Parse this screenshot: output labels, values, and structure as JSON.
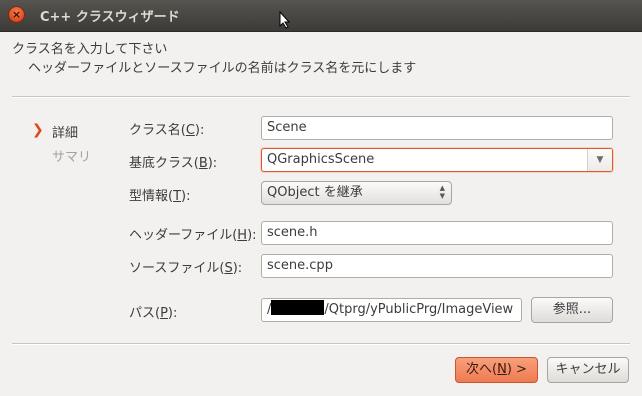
{
  "window": {
    "title": "C++ クラスウィザード",
    "close_glyph": "×"
  },
  "header": {
    "line1": "クラス名を入力して下さい",
    "line2": "ヘッダーファイルとソースファイルの名前はクラス名を元にします"
  },
  "sidebar": {
    "active_marker": "❯",
    "items": [
      {
        "label": "詳細",
        "active": true
      },
      {
        "label": "サマリ",
        "active": false
      }
    ]
  },
  "form": {
    "class_name": {
      "label_pre": "クラス名(",
      "mnemonic": "C",
      "label_post": "):",
      "value": "Scene"
    },
    "base_class": {
      "label_pre": "基底クラス(",
      "mnemonic": "B",
      "label_post": "):",
      "value": "QGraphicsScene"
    },
    "type_info": {
      "label_pre": "型情報(",
      "mnemonic": "T",
      "label_post": "):",
      "value": "QObject を継承"
    },
    "header_file": {
      "label_pre": "ヘッダーファイル(",
      "mnemonic": "H",
      "label_post": "):",
      "value": "scene.h"
    },
    "source_file": {
      "label_pre": "ソースファイル(",
      "mnemonic": "S",
      "label_post": "):",
      "value": "scene.cpp"
    },
    "path": {
      "label_pre": "パス(",
      "mnemonic": "P",
      "label_post": "):",
      "prefix": "/",
      "suffix": "/Qtprg/yPublicPrg/ImageView"
    }
  },
  "buttons": {
    "browse": "参照...",
    "next_pre": "次へ(",
    "next_mnemonic": "N",
    "next_post": ") >",
    "cancel": "キャンセル"
  },
  "colors": {
    "accent": "#dd4814",
    "primary_button": "#f08a62"
  }
}
